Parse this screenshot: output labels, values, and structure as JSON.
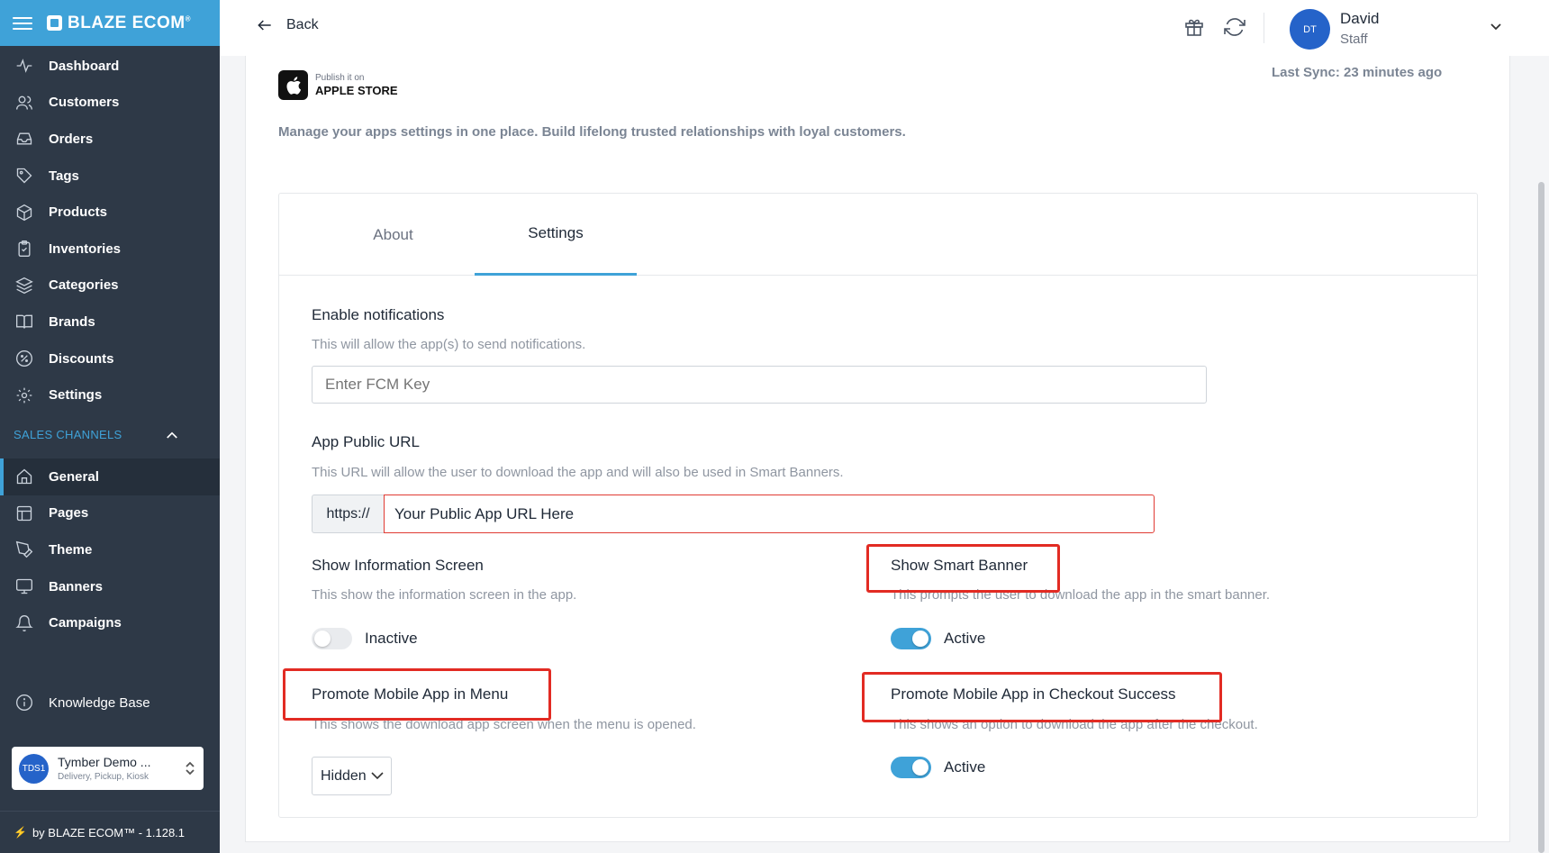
{
  "brand": {
    "name": "BLAZE ECOM",
    "tm": "®"
  },
  "sidebar": {
    "items": [
      {
        "label": "Dashboard",
        "icon": "activity-icon"
      },
      {
        "label": "Customers",
        "icon": "users-icon"
      },
      {
        "label": "Orders",
        "icon": "inbox-icon"
      },
      {
        "label": "Tags",
        "icon": "tag-icon"
      },
      {
        "label": "Products",
        "icon": "box-icon"
      },
      {
        "label": "Inventories",
        "icon": "clipboard-icon"
      },
      {
        "label": "Categories",
        "icon": "layers-icon"
      },
      {
        "label": "Brands",
        "icon": "book-icon"
      },
      {
        "label": "Discounts",
        "icon": "percent-icon"
      },
      {
        "label": "Settings",
        "icon": "gear-icon"
      }
    ],
    "sales_channels_label": "SALES CHANNELS",
    "channel_items": [
      {
        "label": "General",
        "icon": "home-icon",
        "active": true
      },
      {
        "label": "Pages",
        "icon": "layout-icon"
      },
      {
        "label": "Theme",
        "icon": "pen-icon"
      },
      {
        "label": "Banners",
        "icon": "monitor-icon"
      },
      {
        "label": "Campaigns",
        "icon": "bell-icon"
      }
    ],
    "knowledge_base": "Knowledge Base",
    "store": {
      "initials": "TDS1",
      "name": "Tymber Demo ...",
      "sub": "Delivery, Pickup, Kiosk"
    },
    "footer": "by BLAZE ECOM™ - 1.128.1"
  },
  "topbar": {
    "back_label": "Back",
    "user": {
      "initials": "DT",
      "name": "David",
      "role": "Staff"
    }
  },
  "page": {
    "badge_small": "Publish it on",
    "badge_big": "APPLE STORE",
    "last_sync": "Last Sync: 23 minutes ago",
    "description": "Manage your apps settings in one place. Build lifelong trusted relationships with loyal customers.",
    "tabs": [
      "About",
      "Settings"
    ],
    "active_tab": "Settings"
  },
  "settings": {
    "notifications": {
      "title": "Enable notifications",
      "help": "This will allow the app(s) to send notifications.",
      "placeholder": "Enter FCM Key"
    },
    "public_url": {
      "title": "App Public URL",
      "help": "This URL will allow the user to download the app and will also be used in Smart Banners.",
      "prefix": "https://",
      "value": "Your Public App URL Here"
    },
    "info_screen": {
      "title": "Show Information Screen",
      "help": "This show the information screen in the app.",
      "state": "Inactive"
    },
    "smart_banner": {
      "title": "Show Smart Banner",
      "help": "This prompts the user to download the app in the smart banner.",
      "state": "Active"
    },
    "promote_menu": {
      "title": "Promote Mobile App in Menu",
      "help": "This shows the download app screen when the menu is opened.",
      "selected": "Hidden"
    },
    "promote_checkout": {
      "title": "Promote Mobile App in Checkout Success",
      "help": "This shows an option to download the app after the checkout.",
      "state": "Active"
    }
  },
  "colors": {
    "accent": "#3fa2d8",
    "sidebar": "#2e3947",
    "highlight": "#e22b23"
  }
}
